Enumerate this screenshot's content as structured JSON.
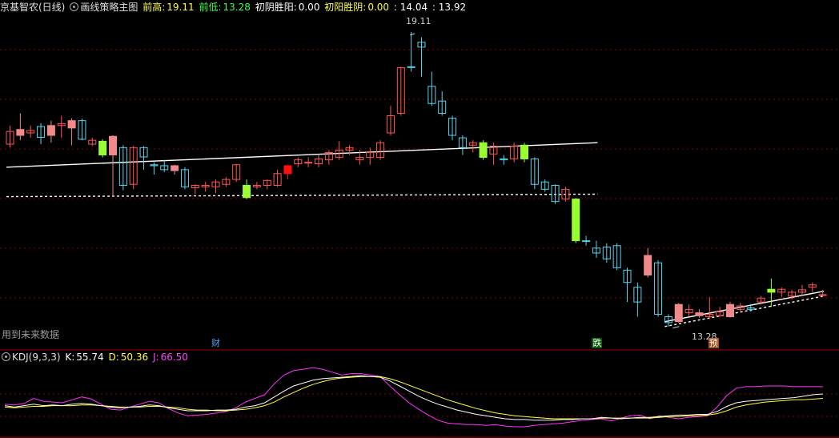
{
  "header": {
    "title": "京基智农(日线)",
    "indicator": "画线策略主图",
    "prev_high_label": "前高:",
    "prev_high": "19.11",
    "prev_low_label": "前低:",
    "prev_low": "13.28",
    "first_yin_win_yang_label": "初阴胜阳:",
    "first_yin_win_yang": "0.00",
    "first_yang_win_yin_label": "初阳胜阴:",
    "first_yang_win_yin": "0.00",
    "extra_a": ": 14.04",
    "extra_b": ": 13.92"
  },
  "note_text": "用到未来数据",
  "markers": {
    "cai": "财",
    "die": "跌",
    "yu": "预"
  },
  "annotations": {
    "high": "19.11",
    "low": "13.28"
  },
  "kdj_header": {
    "name": "KDJ(9,3,3)",
    "k_label": "K:",
    "k": "55.74",
    "d_label": "D:",
    "d": "50.36",
    "j_label": "J:",
    "j": "66.50"
  },
  "colors": {
    "up": "#ff5555",
    "up_fill": "#f08a8a",
    "down": "#54d6ee",
    "signal_green": "#99ff33",
    "signal_red": "#ff1010",
    "k_line": "#ffffff",
    "d_line": "#ffff33",
    "j_line": "#ff33ff",
    "grid": "#8b0000"
  },
  "chart_data": {
    "type": "candlestick",
    "y_range": [
      12.9,
      19.5
    ],
    "candles": [
      {
        "o": 16.82,
        "c": 17.08,
        "h": 17.2,
        "l": 16.75,
        "style": "up"
      },
      {
        "o": 17.0,
        "c": 17.12,
        "h": 17.45,
        "l": 16.9,
        "style": "up_fill"
      },
      {
        "o": 17.1,
        "c": 17.05,
        "h": 17.2,
        "l": 16.95,
        "style": "up"
      },
      {
        "o": 17.18,
        "c": 16.96,
        "h": 17.25,
        "l": 16.82,
        "style": "down"
      },
      {
        "o": 17.0,
        "c": 17.2,
        "h": 17.3,
        "l": 16.85,
        "style": "up_fill"
      },
      {
        "o": 17.2,
        "c": 17.24,
        "h": 17.4,
        "l": 16.95,
        "style": "up"
      },
      {
        "o": 17.15,
        "c": 17.3,
        "h": 17.35,
        "l": 16.8,
        "style": "up_fill"
      },
      {
        "o": 17.3,
        "c": 16.92,
        "h": 17.34,
        "l": 16.9,
        "style": "down"
      },
      {
        "o": 16.9,
        "c": 16.82,
        "h": 16.95,
        "l": 16.78,
        "style": "up"
      },
      {
        "o": 16.88,
        "c": 16.6,
        "h": 16.92,
        "l": 16.55,
        "style": "green"
      },
      {
        "o": 16.6,
        "c": 16.98,
        "h": 17.0,
        "l": 15.75,
        "style": "up_fill"
      },
      {
        "o": 16.75,
        "c": 15.98,
        "h": 16.8,
        "l": 15.88,
        "style": "down"
      },
      {
        "o": 16.0,
        "c": 16.75,
        "h": 16.78,
        "l": 15.9,
        "style": "up"
      },
      {
        "o": 16.75,
        "c": 16.56,
        "h": 16.78,
        "l": 16.3,
        "style": "down"
      },
      {
        "o": 16.38,
        "c": 16.4,
        "h": 16.45,
        "l": 16.2,
        "style": "down"
      },
      {
        "o": 16.38,
        "c": 16.3,
        "h": 16.5,
        "l": 16.25,
        "style": "down"
      },
      {
        "o": 16.38,
        "c": 16.28,
        "h": 16.4,
        "l": 16.2,
        "style": "up_fill"
      },
      {
        "o": 16.3,
        "c": 15.95,
        "h": 16.35,
        "l": 15.9,
        "style": "down"
      },
      {
        "o": 15.93,
        "c": 15.98,
        "h": 16.0,
        "l": 15.8,
        "style": "up"
      },
      {
        "o": 15.95,
        "c": 15.98,
        "h": 16.05,
        "l": 15.85,
        "style": "up"
      },
      {
        "o": 15.95,
        "c": 16.05,
        "h": 16.1,
        "l": 15.82,
        "style": "up"
      },
      {
        "o": 16.0,
        "c": 16.1,
        "h": 16.15,
        "l": 15.95,
        "style": "up"
      },
      {
        "o": 16.1,
        "c": 16.4,
        "h": 16.42,
        "l": 16.05,
        "style": "up"
      },
      {
        "o": 15.98,
        "c": 15.73,
        "h": 16.1,
        "l": 15.7,
        "style": "green"
      },
      {
        "o": 15.95,
        "c": 15.98,
        "h": 16.05,
        "l": 15.9,
        "style": "up"
      },
      {
        "o": 15.98,
        "c": 16.08,
        "h": 16.1,
        "l": 15.9,
        "style": "up"
      },
      {
        "o": 15.98,
        "c": 16.22,
        "h": 16.3,
        "l": 15.95,
        "style": "up"
      },
      {
        "o": 16.22,
        "c": 16.38,
        "h": 16.4,
        "l": 16.1,
        "style": "signal_red"
      },
      {
        "o": 16.42,
        "c": 16.5,
        "h": 16.55,
        "l": 16.35,
        "style": "up"
      },
      {
        "o": 16.45,
        "c": 16.45,
        "h": 16.55,
        "l": 16.35,
        "style": "up"
      },
      {
        "o": 16.42,
        "c": 16.52,
        "h": 16.6,
        "l": 16.35,
        "style": "up"
      },
      {
        "o": 16.5,
        "c": 16.65,
        "h": 16.7,
        "l": 16.4,
        "style": "up"
      },
      {
        "o": 16.55,
        "c": 16.7,
        "h": 16.88,
        "l": 16.5,
        "style": "up"
      },
      {
        "o": 16.7,
        "c": 16.75,
        "h": 16.8,
        "l": 16.6,
        "style": "up"
      },
      {
        "o": 16.5,
        "c": 16.55,
        "h": 16.7,
        "l": 16.4,
        "style": "up"
      },
      {
        "o": 16.55,
        "c": 16.65,
        "h": 16.75,
        "l": 16.4,
        "style": "up"
      },
      {
        "o": 16.55,
        "c": 16.85,
        "h": 16.9,
        "l": 16.5,
        "style": "up"
      },
      {
        "o": 17.05,
        "c": 17.4,
        "h": 17.6,
        "l": 17.0,
        "style": "up"
      },
      {
        "o": 17.45,
        "c": 18.38,
        "h": 18.4,
        "l": 17.4,
        "style": "up"
      },
      {
        "o": 18.4,
        "c": 18.4,
        "h": 19.11,
        "l": 18.3,
        "style": "down"
      },
      {
        "o": 18.8,
        "c": 18.9,
        "h": 19.0,
        "l": 18.2,
        "style": "down"
      },
      {
        "o": 18.0,
        "c": 17.65,
        "h": 18.3,
        "l": 17.6,
        "style": "down"
      },
      {
        "o": 17.7,
        "c": 17.45,
        "h": 17.9,
        "l": 17.4,
        "style": "down"
      },
      {
        "o": 17.35,
        "c": 17.0,
        "h": 17.4,
        "l": 16.9,
        "style": "down"
      },
      {
        "o": 16.95,
        "c": 16.75,
        "h": 17.0,
        "l": 16.6,
        "style": "down"
      },
      {
        "o": 16.85,
        "c": 16.8,
        "h": 16.9,
        "l": 16.65,
        "style": "up"
      },
      {
        "o": 16.85,
        "c": 16.55,
        "h": 16.9,
        "l": 16.5,
        "style": "green"
      },
      {
        "o": 16.62,
        "c": 16.78,
        "h": 16.85,
        "l": 16.4,
        "style": "up"
      },
      {
        "o": 16.5,
        "c": 16.52,
        "h": 16.6,
        "l": 16.4,
        "style": "down"
      },
      {
        "o": 16.78,
        "c": 16.52,
        "h": 16.85,
        "l": 16.45,
        "style": "up"
      },
      {
        "o": 16.8,
        "c": 16.52,
        "h": 16.85,
        "l": 16.45,
        "style": "green"
      },
      {
        "o": 16.52,
        "c": 16.0,
        "h": 16.55,
        "l": 15.9,
        "style": "down"
      },
      {
        "o": 16.05,
        "c": 15.9,
        "h": 16.1,
        "l": 15.85,
        "style": "down"
      },
      {
        "o": 15.98,
        "c": 15.65,
        "h": 16.0,
        "l": 15.6,
        "style": "down"
      },
      {
        "o": 15.9,
        "c": 15.7,
        "h": 15.95,
        "l": 15.65,
        "style": "up"
      },
      {
        "o": 15.7,
        "c": 14.85,
        "h": 15.72,
        "l": 14.8,
        "style": "green"
      },
      {
        "o": 14.85,
        "c": 14.85,
        "h": 14.95,
        "l": 14.75,
        "style": "down"
      },
      {
        "o": 14.7,
        "c": 14.6,
        "h": 14.85,
        "l": 14.5,
        "style": "down"
      },
      {
        "o": 14.72,
        "c": 14.48,
        "h": 14.8,
        "l": 14.4,
        "style": "down"
      },
      {
        "o": 14.75,
        "c": 14.3,
        "h": 14.8,
        "l": 14.25,
        "style": "down"
      },
      {
        "o": 14.25,
        "c": 14.0,
        "h": 14.3,
        "l": 13.6,
        "style": "down"
      },
      {
        "o": 13.9,
        "c": 13.6,
        "h": 14.0,
        "l": 13.3,
        "style": "down"
      },
      {
        "o": 14.15,
        "c": 14.55,
        "h": 14.7,
        "l": 14.1,
        "style": "up_fill"
      },
      {
        "o": 14.4,
        "c": 13.35,
        "h": 14.45,
        "l": 13.3,
        "style": "down"
      },
      {
        "o": 13.3,
        "c": 13.18,
        "h": 13.35,
        "l": 13.1,
        "style": "down"
      },
      {
        "o": 13.2,
        "c": 13.55,
        "h": 13.58,
        "l": 13.18,
        "style": "up_fill"
      },
      {
        "o": 13.38,
        "c": 13.45,
        "h": 13.55,
        "l": 13.3,
        "style": "up"
      },
      {
        "o": 13.38,
        "c": 13.32,
        "h": 13.45,
        "l": 13.28,
        "style": "up_fill"
      },
      {
        "o": 13.35,
        "c": 13.3,
        "h": 13.7,
        "l": 13.25,
        "style": "up"
      },
      {
        "o": 13.32,
        "c": 13.4,
        "h": 13.5,
        "l": 13.3,
        "style": "up"
      },
      {
        "o": 13.3,
        "c": 13.55,
        "h": 13.6,
        "l": 13.28,
        "style": "up_fill"
      },
      {
        "o": 13.45,
        "c": 13.52,
        "h": 13.58,
        "l": 13.4,
        "style": "up"
      },
      {
        "o": 13.45,
        "c": 13.48,
        "h": 13.56,
        "l": 13.4,
        "style": "down"
      },
      {
        "o": 13.6,
        "c": 13.68,
        "h": 13.72,
        "l": 13.55,
        "style": "up"
      },
      {
        "o": 13.8,
        "c": 13.86,
        "h": 14.08,
        "l": 13.5,
        "style": "green"
      },
      {
        "o": 13.8,
        "c": 13.86,
        "h": 13.9,
        "l": 13.7,
        "style": "up"
      },
      {
        "o": 13.72,
        "c": 13.8,
        "h": 13.85,
        "l": 13.65,
        "style": "up"
      },
      {
        "o": 13.85,
        "c": 13.8,
        "h": 13.95,
        "l": 13.72,
        "style": "up"
      },
      {
        "o": 13.9,
        "c": 13.95,
        "h": 14.0,
        "l": 13.8,
        "style": "up"
      },
      {
        "o": 13.75,
        "c": 13.75,
        "h": 13.85,
        "l": 13.7,
        "style": "up"
      }
    ],
    "trendlines": [
      {
        "from": [
          0,
          16.35
        ],
        "to": [
          57,
          16.85
        ],
        "style": "solid"
      },
      {
        "from": [
          0,
          15.75
        ],
        "to": [
          57,
          15.8
        ],
        "style": "dashed"
      },
      {
        "from": [
          64,
          13.2
        ],
        "to": [
          79,
          13.82
        ],
        "style": "solid"
      },
      {
        "from": [
          64,
          13.1
        ],
        "to": [
          79,
          13.72
        ],
        "style": "dashed"
      }
    ],
    "marker_positions": {
      "cai": 20,
      "die": 57,
      "yu": 68
    },
    "kdj": {
      "y_range": [
        0,
        100
      ],
      "K": [
        40,
        38,
        40,
        42,
        40,
        41,
        40,
        42,
        43,
        42,
        40,
        38,
        37,
        38,
        39,
        41,
        40,
        37,
        35,
        33,
        33,
        33,
        34,
        34,
        35,
        38,
        40,
        44,
        52,
        60,
        67,
        71,
        75,
        77,
        78,
        79,
        80,
        81,
        80,
        79,
        74,
        67,
        60,
        53,
        47,
        42,
        38,
        34,
        31,
        28,
        26,
        24,
        22,
        21,
        21,
        20,
        20,
        20,
        21,
        21,
        22,
        22,
        24,
        23,
        22,
        23,
        24,
        24,
        25,
        26,
        27,
        27,
        28,
        28,
        32,
        39,
        44,
        46,
        47,
        48,
        49,
        50,
        51,
        53,
        55,
        56
      ],
      "D": [
        38,
        37,
        38,
        39,
        39,
        40,
        40,
        40,
        41,
        41,
        40,
        39,
        38,
        38,
        38,
        39,
        39,
        38,
        37,
        35,
        34,
        34,
        33,
        33,
        34,
        35,
        37,
        40,
        45,
        52,
        58,
        64,
        69,
        73,
        76,
        78,
        79,
        80,
        80,
        80,
        77,
        73,
        68,
        63,
        58,
        53,
        48,
        44,
        40,
        36,
        33,
        30,
        28,
        26,
        25,
        24,
        23,
        22,
        22,
        22,
        22,
        22,
        23,
        23,
        23,
        23,
        23,
        23,
        24,
        25,
        25,
        26,
        26,
        27,
        29,
        33,
        38,
        41,
        43,
        45,
        46,
        47,
        48,
        48,
        49,
        50
      ],
      "J": [
        42,
        41,
        43,
        50,
        46,
        45,
        44,
        48,
        52,
        49,
        42,
        35,
        34,
        38,
        42,
        46,
        44,
        36,
        30,
        26,
        27,
        28,
        30,
        32,
        37,
        45,
        50,
        55,
        70,
        82,
        88,
        90,
        92,
        90,
        86,
        82,
        84,
        84,
        82,
        80,
        67,
        55,
        44,
        35,
        27,
        20,
        16,
        15,
        14,
        14,
        13,
        14,
        12,
        11,
        11,
        13,
        14,
        15,
        16,
        18,
        20,
        21,
        22,
        19,
        23,
        26,
        27,
        22,
        26,
        24,
        22,
        24,
        25,
        26,
        38,
        54,
        64,
        66,
        66,
        67,
        67,
        67,
        66,
        66,
        66,
        66
      ]
    }
  }
}
